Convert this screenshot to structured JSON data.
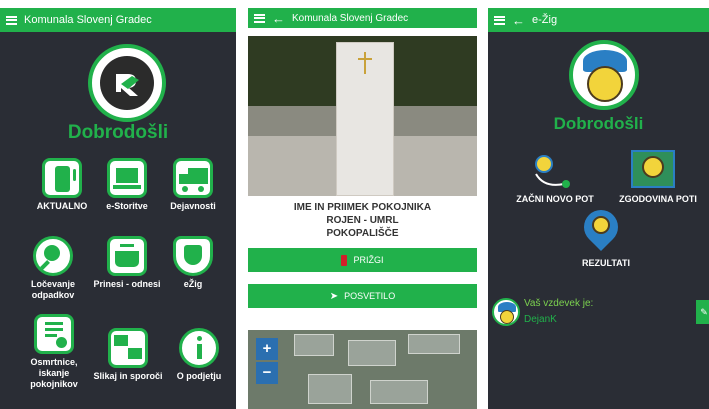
{
  "screen1": {
    "title": "Komunala Slovenj Gradec",
    "welcome": "Dobrodošli",
    "tiles": [
      {
        "label": "AKTUALNO",
        "icon": "phone-icon"
      },
      {
        "label": "e-Storitve",
        "icon": "laptop-icon"
      },
      {
        "label": "Dejavnosti",
        "icon": "truck-icon"
      },
      {
        "label": "Ločevanje odpadkov",
        "icon": "magnifier-icon"
      },
      {
        "label": "Prinesi - odnesi",
        "icon": "basket-icon"
      },
      {
        "label": "eŽig",
        "icon": "shield-icon"
      },
      {
        "label": "Osmrtnice, iskanje pokojnikov",
        "icon": "document-icon"
      },
      {
        "label": "Slikaj in sporoči",
        "icon": "computers-icon"
      },
      {
        "label": "O podjetju",
        "icon": "info-icon"
      }
    ]
  },
  "screen2": {
    "title": "Komunala Slovenj Gradec",
    "name_line": "IME IN PRIIMEK POKOJNIKA",
    "dates_line": "ROJEN - UMRL",
    "cemetery_line": "POKOPALIŠČE",
    "light_button": "PRIŽGI",
    "dedicate_button": "POSVETILO",
    "zoom_in": "+",
    "zoom_out": "−"
  },
  "screen3": {
    "title": "e-Žig",
    "welcome": "Dobrodošli",
    "start_route": "ZAČNI NOVO POT",
    "route_history": "ZGODOVINA POTI",
    "results": "REZULTATI",
    "nickname_label": "Vaš vzdevek je:",
    "nickname": "DejanK"
  },
  "colors": {
    "accent": "#21b14b",
    "dark_bg": "#2a2d35",
    "map_button": "#2b6fb0"
  }
}
